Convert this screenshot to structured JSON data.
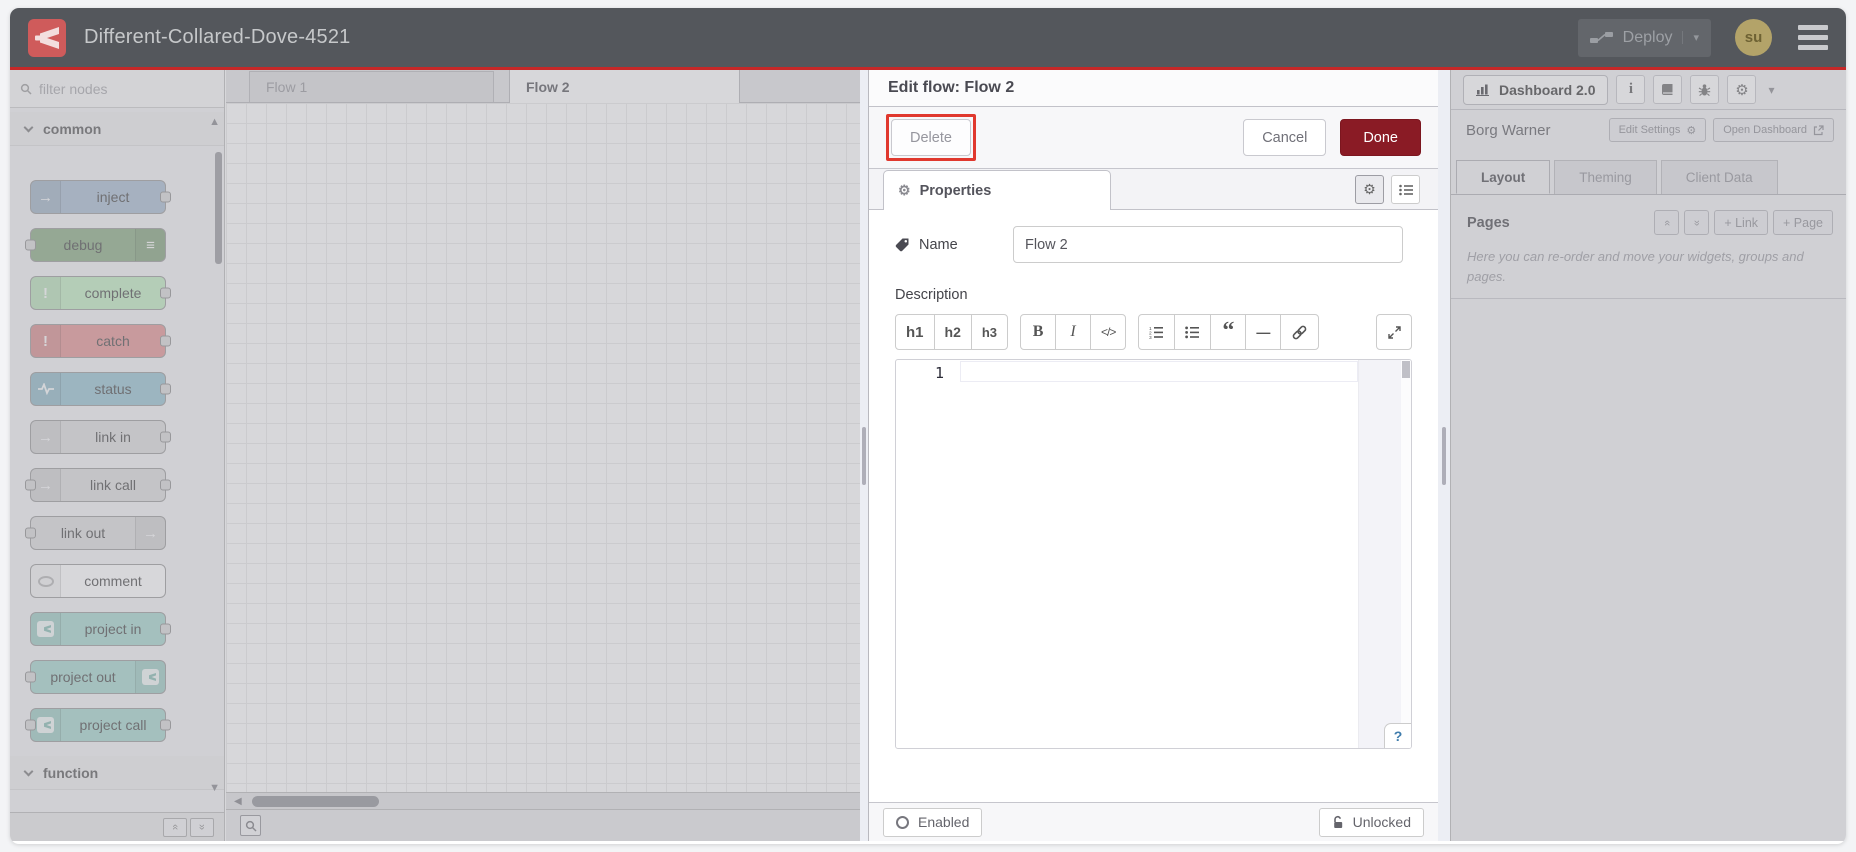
{
  "header": {
    "title": "Different-Collared-Dove-4521",
    "deploy_label": "Deploy",
    "avatar_initials": "su"
  },
  "palette": {
    "filter_placeholder": "filter nodes",
    "categories": [
      {
        "label": "common"
      },
      {
        "label": "function"
      }
    ],
    "nodes": [
      {
        "label": "inject",
        "color": "#a6bbcf",
        "icon": "inject-arrow-icon"
      },
      {
        "label": "debug",
        "color": "#87a980",
        "icon": "debug-list-icon"
      },
      {
        "label": "complete",
        "color": "#c0edc0",
        "icon": "exclamation-icon"
      },
      {
        "label": "catch",
        "color": "#e49191",
        "icon": "exclamation-icon"
      },
      {
        "label": "status",
        "color": "#94c1d0",
        "icon": "pulse-icon"
      },
      {
        "label": "link in",
        "color": "#dddddd",
        "icon": "link-arrow-icon"
      },
      {
        "label": "link call",
        "color": "#dddddd",
        "icon": "link-arrow-icon"
      },
      {
        "label": "link out",
        "color": "#dddddd",
        "icon": "link-arrow-icon"
      },
      {
        "label": "comment",
        "color": "#ffffff",
        "icon": "comment-bubble-icon"
      },
      {
        "label": "project in",
        "color": "#a3d5cc",
        "icon": "node-red-icon"
      },
      {
        "label": "project out",
        "color": "#a3d5cc",
        "icon": "node-red-icon"
      },
      {
        "label": "project call",
        "color": "#a3d5cc",
        "icon": "node-red-icon"
      }
    ]
  },
  "workspace": {
    "tabs": [
      {
        "label": "Flow 1"
      },
      {
        "label": "Flow 2"
      }
    ],
    "active_tab": "Flow 2"
  },
  "tray": {
    "title": "Edit flow: Flow 2",
    "delete_label": "Delete",
    "cancel_label": "Cancel",
    "done_label": "Done",
    "properties_tab": "Properties",
    "name_label": "Name",
    "name_value": "Flow 2",
    "description_label": "Description",
    "md": {
      "h1": "h1",
      "h2": "h2",
      "h3": "h3",
      "bold": "B",
      "italic": "I",
      "code": "</>"
    },
    "md_icons": [
      "ordered-list-icon",
      "unordered-list-icon",
      "quote-icon",
      "horizontal-rule-icon",
      "link-icon",
      "expand-icon"
    ],
    "editor_line_number": "1",
    "help_button": "?",
    "enabled_label": "Enabled",
    "locked_label": "Unlocked"
  },
  "sidebar": {
    "dashboard_tab": "Dashboard 2.0",
    "toolbar_icons": [
      "info-icon",
      "book-icon",
      "bug-icon",
      "gear-icon",
      "caret-down-icon"
    ],
    "project_name": "Borg Warner",
    "edit_settings_label": "Edit Settings",
    "open_dashboard_label": "Open Dashboard",
    "tabs": [
      {
        "label": "Layout"
      },
      {
        "label": "Theming"
      },
      {
        "label": "Client Data"
      }
    ],
    "pages_heading": "Pages",
    "add_link_label": "+ Link",
    "add_page_label": "+ Page",
    "help_text": "Here you can re-order and move your widgets, groups and pages."
  },
  "colors": {
    "header_bg": "#54575c",
    "header_accent_line": "#c62828",
    "done_button": "#8a1b25",
    "annotation_red": "#e0382e",
    "avatar_bg": "#b3a369"
  }
}
